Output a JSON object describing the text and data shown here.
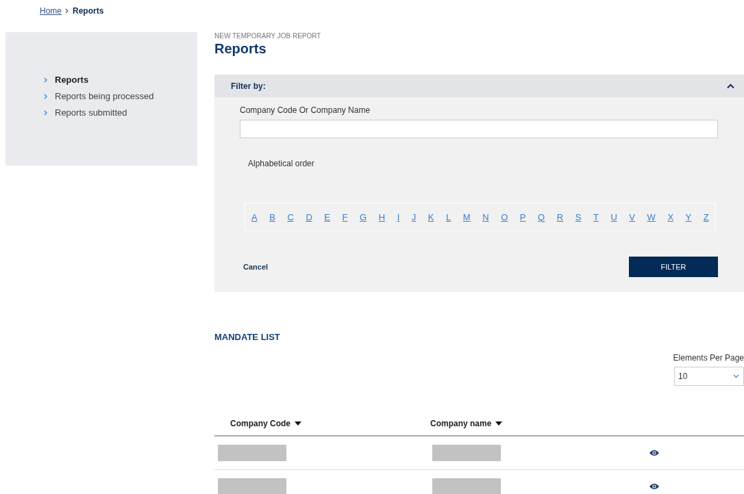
{
  "breadcrumb": [
    {
      "label": "Home",
      "link": true
    },
    {
      "label": "Reports",
      "link": false
    }
  ],
  "sidebar": {
    "items": [
      {
        "label": "Reports",
        "selected": true
      },
      {
        "label": "Reports being processed",
        "selected": false
      },
      {
        "label": "Reports submitted",
        "selected": false
      }
    ]
  },
  "page": {
    "overline": "NEW TEMPORARY JOB REPORT",
    "title": "Reports"
  },
  "filter": {
    "title": "Filter by:",
    "expanded": true,
    "field_label": "Company Code Or Company Name",
    "alphabet_label": "Alphabetical order",
    "letters": [
      "A",
      "B",
      "C",
      "D",
      "E",
      "F",
      "G",
      "H",
      "I",
      "J",
      "K",
      "L",
      "M",
      "N",
      "O",
      "P",
      "Q",
      "R",
      "S",
      "T",
      "U",
      "V",
      "W",
      "X",
      "Y",
      "Z"
    ],
    "cancel": "Cancel",
    "submit": "FILTER"
  },
  "list": {
    "title": "MANDATE LIST",
    "per_page_label": "Elements Per Page",
    "per_page": "10",
    "columns": [
      "Company Code",
      "Company name"
    ],
    "rows": [
      {
        "cells": [
          {
            "kind": "redacted"
          },
          {
            "kind": "redacted"
          }
        ]
      },
      {
        "cells": [
          {
            "kind": "redacted"
          },
          {
            "kind": "redacted"
          }
        ]
      }
    ]
  }
}
